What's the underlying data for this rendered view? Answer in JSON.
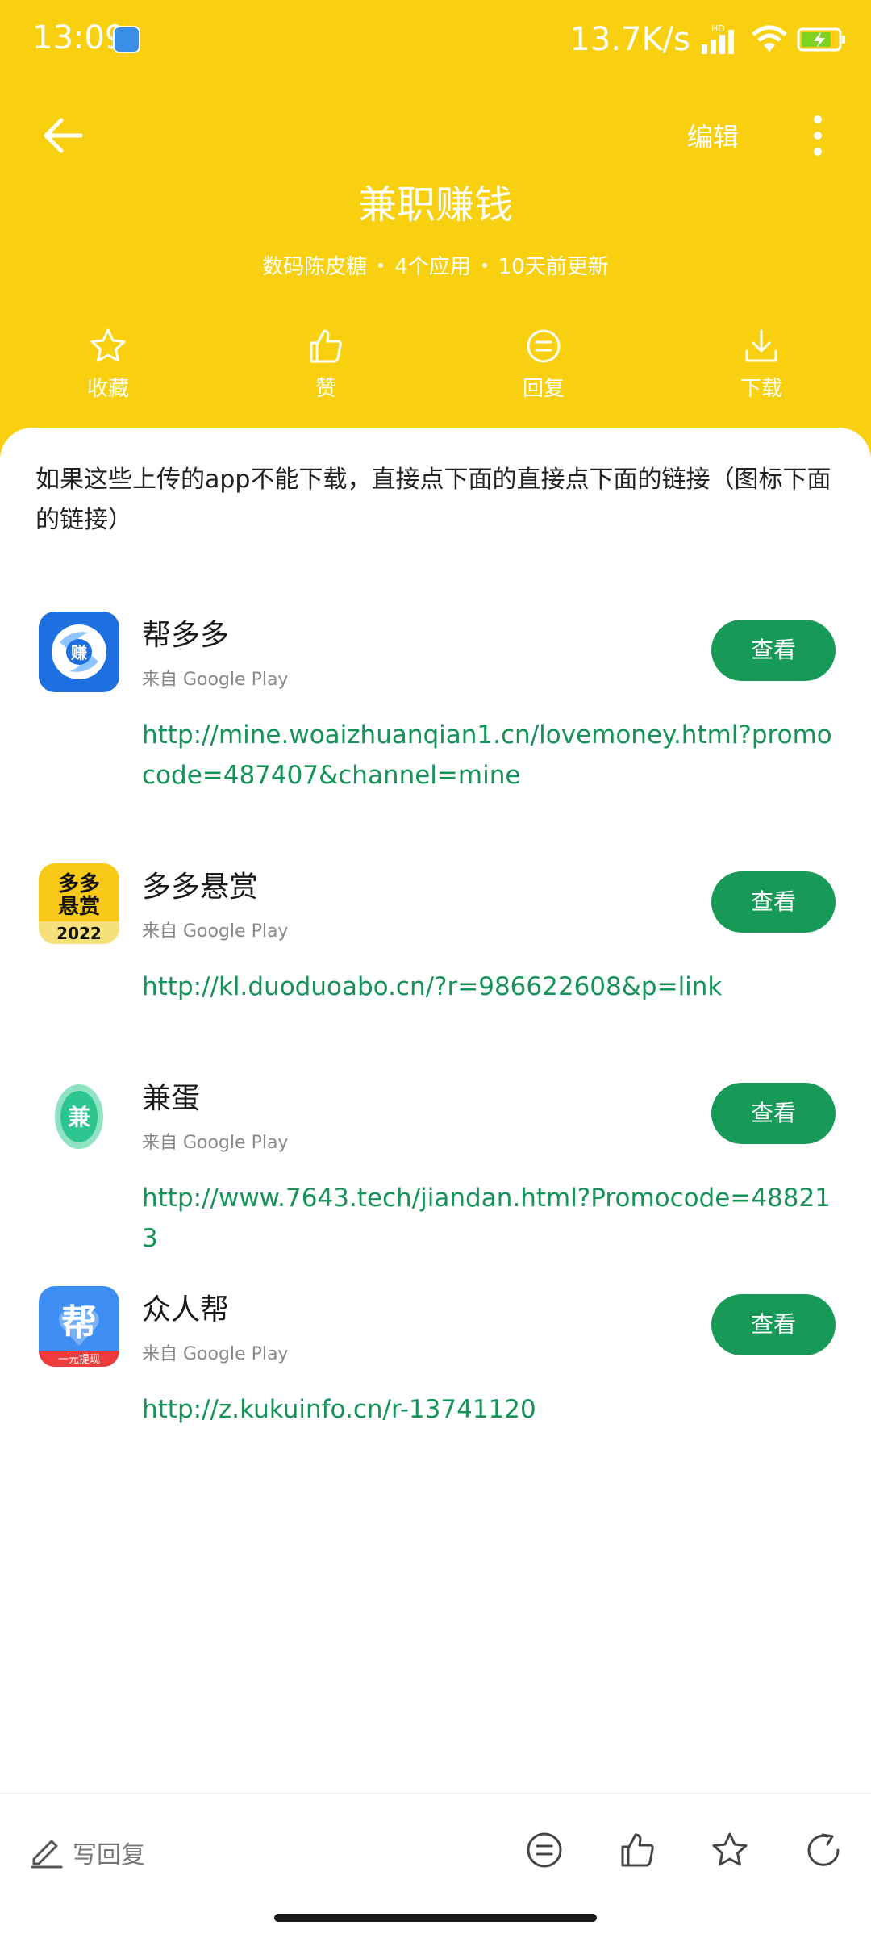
{
  "status_bar": {
    "time": "13:09",
    "net_speed": "13.7K/s",
    "signal_label": "HD"
  },
  "topbar": {
    "edit_label": "编辑"
  },
  "header": {
    "title": "兼职赚钱",
    "author": "数码陈皮糖",
    "app_count": "4个应用",
    "updated": "10天前更新"
  },
  "actions": [
    {
      "label": "收藏",
      "icon": "star-icon"
    },
    {
      "label": "赞",
      "icon": "thumbs-up-icon"
    },
    {
      "label": "回复",
      "icon": "comment-icon"
    },
    {
      "label": "下载",
      "icon": "download-icon"
    }
  ],
  "intro": "如果这些上传的app不能下载，直接点下面的直接点下面的链接（图标下面的链接）",
  "apps": [
    {
      "name": "帮多多",
      "source": "来自 Google Play",
      "button": "查看",
      "link": "http://mine.woaizhuanqian1.cn/lovemoney.html?promocode=487407&channel=mine",
      "icon_text": "赚"
    },
    {
      "name": "多多悬赏",
      "source": "来自 Google Play",
      "button": "查看",
      "link": "http://kl.duoduoabo.cn/?r=986622608&p=link",
      "icon_text_1": "多多",
      "icon_text_2": "悬赏",
      "icon_year": "2022"
    },
    {
      "name": "兼蛋",
      "source": "来自 Google Play",
      "button": "查看",
      "link": "http://www.7643.tech/jiandan.html?Promocode=488213",
      "icon_text": "兼"
    },
    {
      "name": "众人帮",
      "source": "来自 Google Play",
      "button": "查看",
      "link": "http://z.kukuinfo.cn/r-13741120",
      "icon_text": "帮",
      "icon_sub": "一元提现"
    }
  ],
  "bottom_bar": {
    "reply_placeholder": "写回复"
  },
  "colors": {
    "header": "#f9d00f",
    "accent_green": "#179a57",
    "link_green": "#159257"
  }
}
